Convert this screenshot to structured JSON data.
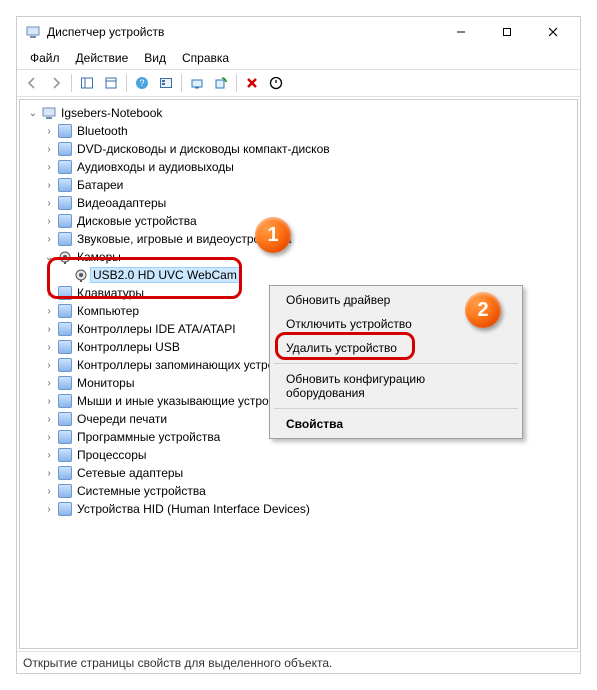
{
  "window": {
    "title": "Диспетчер устройств"
  },
  "menu": {
    "file": "Файл",
    "action": "Действие",
    "view": "Вид",
    "help": "Справка"
  },
  "tree": {
    "root": "Igsebers-Notebook",
    "items": [
      "Bluetooth",
      "DVD-дисководы и дисководы компакт-дисков",
      "Аудиовходы и аудиовыходы",
      "Батареи",
      "Видеоадаптеры",
      "Дисковые устройства",
      "Звуковые, игровые и видеоустройства"
    ],
    "cameras": {
      "label": "Камеры",
      "child": "USB2.0 HD UVC WebCam"
    },
    "after": [
      "Клавиатуры",
      "Компьютер",
      "Контроллеры IDE ATA/ATAPI",
      "Контроллеры USB",
      "Контроллеры запоминающих устройств",
      "Мониторы",
      "Мыши и иные указывающие устройства",
      "Очереди печати",
      "Программные устройства",
      "Процессоры",
      "Сетевые адаптеры",
      "Системные устройства",
      "Устройства HID (Human Interface Devices)"
    ]
  },
  "context": {
    "update": "Обновить драйвер",
    "disable": "Отключить устройство",
    "remove": "Удалить устройство",
    "refresh": "Обновить конфигурацию оборудования",
    "props": "Свойства"
  },
  "status": "Открытие страницы свойств для выделенного объекта.",
  "callouts": {
    "one": "1",
    "two": "2"
  }
}
